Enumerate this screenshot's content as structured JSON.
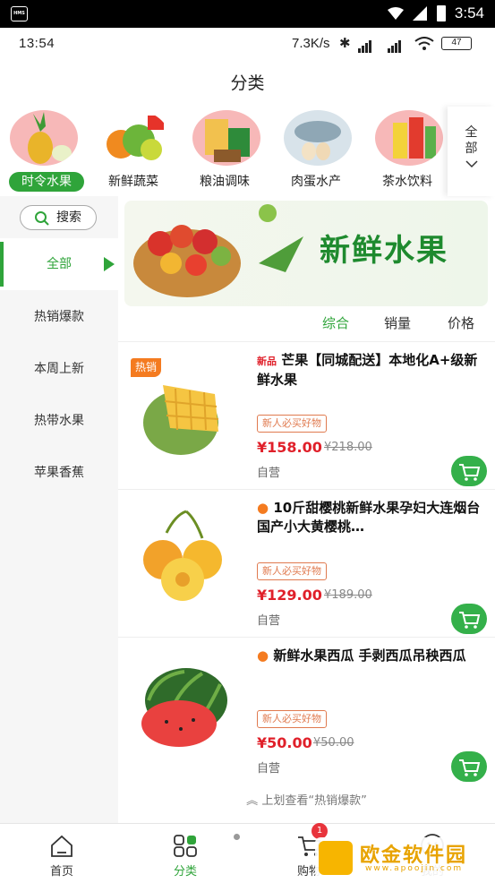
{
  "system_bar": {
    "time": "3:54",
    "hms": "HMS"
  },
  "phone_status": {
    "time": "13:54",
    "speed": "7.3K/s",
    "battery": "47"
  },
  "header": {
    "title": "分类"
  },
  "categories": [
    {
      "label": "时令水果",
      "active": true
    },
    {
      "label": "新鲜蔬菜",
      "active": false
    },
    {
      "label": "粮油调味",
      "active": false
    },
    {
      "label": "肉蛋水产",
      "active": false
    },
    {
      "label": "茶水饮料",
      "active": false
    }
  ],
  "all_toggle": {
    "line1": "全",
    "line2": "部"
  },
  "sidebar": {
    "search_label": "搜索",
    "items": [
      {
        "label": "全部",
        "active": true
      },
      {
        "label": "热销爆款"
      },
      {
        "label": "本周上新"
      },
      {
        "label": "热带水果"
      },
      {
        "label": "苹果香蕉"
      }
    ]
  },
  "banner": {
    "text": "新鲜水果"
  },
  "sort_tabs": [
    {
      "label": "综合",
      "active": true
    },
    {
      "label": "销量"
    },
    {
      "label": "价格"
    }
  ],
  "products": [
    {
      "badge": "热销",
      "name_tag": "新品",
      "name": "芒果【同城配送】本地化A+级新鲜水果",
      "tag": "新人必买好物",
      "price": "¥158.00",
      "original_price": "¥218.00",
      "seller": "自营"
    },
    {
      "name": "10斤甜樱桃新鲜水果孕妇大连烟台国产小大黄樱桃…",
      "tag": "新人必买好物",
      "price": "¥129.00",
      "original_price": "¥189.00",
      "seller": "自营"
    },
    {
      "name": "新鲜水果西瓜 手剥西瓜吊秧西瓜",
      "tag": "新人必买好物",
      "price": "¥50.00",
      "original_price": "¥50.00",
      "seller": "自营"
    }
  ],
  "pull_up_hint": "上划查看“热销爆款”",
  "bottom_nav": [
    {
      "label": "首页"
    },
    {
      "label": "分类",
      "active": true
    },
    {
      "label": "购物"
    },
    {
      "label": "我的"
    }
  ],
  "cart_badge": "1",
  "watermark": {
    "title": "欧金软件园",
    "url": "www.apoojin.com"
  },
  "colors": {
    "accent": "#2fa43a",
    "price": "#e0202a",
    "tag": "#e07a4f"
  }
}
